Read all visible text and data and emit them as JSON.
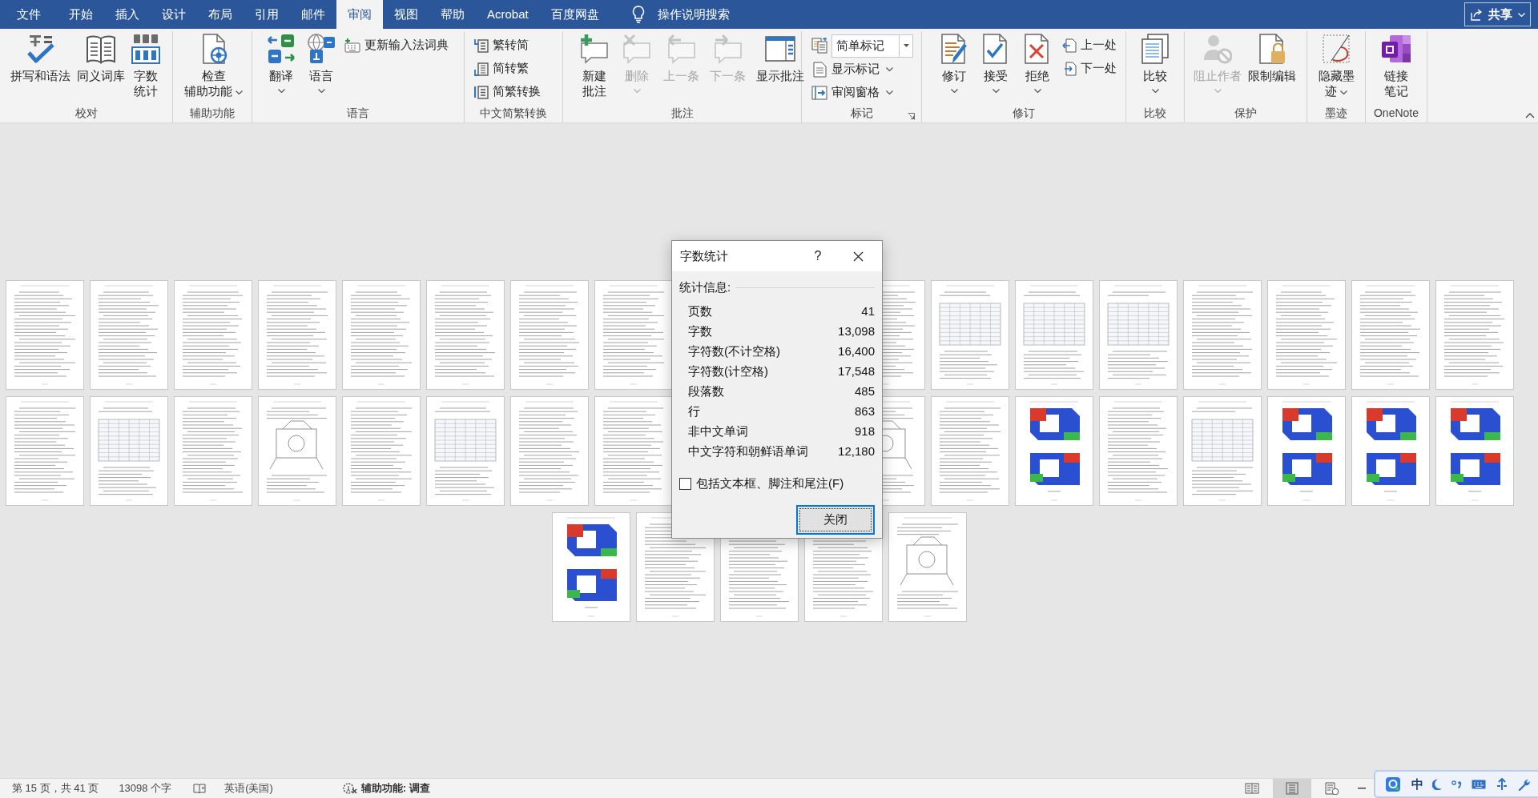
{
  "tabs": [
    {
      "label": "文件",
      "selected": false
    },
    {
      "label": "开始",
      "selected": false
    },
    {
      "label": "插入",
      "selected": false
    },
    {
      "label": "设计",
      "selected": false
    },
    {
      "label": "布局",
      "selected": false
    },
    {
      "label": "引用",
      "selected": false
    },
    {
      "label": "邮件",
      "selected": false
    },
    {
      "label": "审阅",
      "selected": true
    },
    {
      "label": "视图",
      "selected": false
    },
    {
      "label": "帮助",
      "selected": false
    },
    {
      "label": "Acrobat",
      "selected": false
    },
    {
      "label": "百度网盘",
      "selected": false
    }
  ],
  "search": {
    "placeholder": "操作说明搜索"
  },
  "share_button": {
    "label": "共享"
  },
  "ribbon": {
    "groups": [
      {
        "label": "校对",
        "launcher": false,
        "controls": [
          {
            "kind": "large",
            "lines": [
              "拼写和语法"
            ],
            "dropdown": false,
            "disabled": false
          },
          {
            "kind": "large",
            "lines": [
              "同义词库"
            ],
            "dropdown": false,
            "disabled": false
          },
          {
            "kind": "large",
            "lines": [
              "字数",
              "统计"
            ],
            "dropdown": false,
            "disabled": false
          }
        ]
      },
      {
        "label": "辅助功能",
        "launcher": false,
        "controls": [
          {
            "kind": "large",
            "lines": [
              "检查",
              "辅助功能"
            ],
            "dropdown": true,
            "disabled": false
          }
        ]
      },
      {
        "label": "语言",
        "launcher": false,
        "controls": [
          {
            "kind": "large",
            "lines": [
              "翻译"
            ],
            "dropdown": true,
            "disabled": false
          },
          {
            "kind": "large",
            "lines": [
              "语言"
            ],
            "dropdown": true,
            "disabled": false
          },
          {
            "kind": "stack",
            "items": [
              {
                "kind": "small",
                "label": "更新输入法词典",
                "dropdown": false,
                "disabled": false
              }
            ]
          }
        ]
      },
      {
        "label": "中文简繁转换",
        "launcher": false,
        "controls": [
          {
            "kind": "stack",
            "items": [
              {
                "kind": "small",
                "label": "繁转简",
                "dropdown": false,
                "disabled": false
              },
              {
                "kind": "small",
                "label": "简转繁",
                "dropdown": false,
                "disabled": false
              },
              {
                "kind": "small",
                "label": "简繁转换",
                "dropdown": false,
                "disabled": false
              }
            ]
          }
        ]
      },
      {
        "label": "批注",
        "launcher": false,
        "controls": [
          {
            "kind": "large",
            "lines": [
              "新建",
              "批注"
            ],
            "dropdown": false,
            "disabled": false
          },
          {
            "kind": "large",
            "lines": [
              "删除"
            ],
            "dropdown": true,
            "disabled": true
          },
          {
            "kind": "large",
            "lines": [
              "上一条"
            ],
            "dropdown": false,
            "disabled": true
          },
          {
            "kind": "large",
            "lines": [
              "下一条"
            ],
            "dropdown": false,
            "disabled": true
          },
          {
            "kind": "large",
            "lines": [
              "显示批注"
            ],
            "dropdown": false,
            "disabled": false
          }
        ]
      },
      {
        "label": "标记",
        "launcher": true,
        "controls": [
          {
            "kind": "stack",
            "items": [
              {
                "kind": "combo",
                "value": "简单标记"
              },
              {
                "kind": "small",
                "label": "显示标记",
                "dropdown": true,
                "disabled": false
              },
              {
                "kind": "small",
                "label": "审阅窗格",
                "dropdown": true,
                "disabled": false
              }
            ]
          }
        ]
      },
      {
        "label": "修订",
        "launcher": false,
        "controls": [
          {
            "kind": "large",
            "lines": [
              "修订"
            ],
            "dropdown": true,
            "disabled": false
          },
          {
            "kind": "large",
            "lines": [
              "接受"
            ],
            "dropdown": true,
            "disabled": false
          },
          {
            "kind": "large",
            "lines": [
              "拒绝"
            ],
            "dropdown": true,
            "disabled": false
          },
          {
            "kind": "stack",
            "items": [
              {
                "kind": "small",
                "label": "上一处",
                "dropdown": false,
                "disabled": false
              },
              {
                "kind": "small",
                "label": "下一处",
                "dropdown": false,
                "disabled": false
              }
            ]
          }
        ]
      },
      {
        "label": "比较",
        "launcher": false,
        "controls": [
          {
            "kind": "large",
            "lines": [
              "比较"
            ],
            "dropdown": true,
            "disabled": false
          }
        ]
      },
      {
        "label": "保护",
        "launcher": false,
        "controls": [
          {
            "kind": "large",
            "lines": [
              "阻止作者"
            ],
            "dropdown": true,
            "disabled": true
          },
          {
            "kind": "large",
            "lines": [
              "限制编辑"
            ],
            "dropdown": false,
            "disabled": false
          }
        ]
      },
      {
        "label": "墨迹",
        "launcher": false,
        "controls": [
          {
            "kind": "large",
            "lines": [
              "隐藏墨",
              "迹"
            ],
            "dropdown": true,
            "disabled": false
          }
        ]
      },
      {
        "label": "OneNote",
        "launcher": false,
        "controls": [
          {
            "kind": "large",
            "lines": [
              "链接",
              "笔记"
            ],
            "dropdown": false,
            "disabled": false
          }
        ]
      }
    ]
  },
  "pages": [
    {
      "kind": "text"
    },
    {
      "kind": "text"
    },
    {
      "kind": "text"
    },
    {
      "kind": "text"
    },
    {
      "kind": "text"
    },
    {
      "kind": "text"
    },
    {
      "kind": "text"
    },
    {
      "kind": "text"
    },
    {
      "kind": "covered"
    },
    {
      "kind": "covered"
    },
    {
      "kind": "text"
    },
    {
      "kind": "table"
    },
    {
      "kind": "table"
    },
    {
      "kind": "table"
    },
    {
      "kind": "text"
    },
    {
      "kind": "text"
    },
    {
      "kind": "text"
    },
    {
      "kind": "text"
    },
    {
      "kind": "text"
    },
    {
      "kind": "table"
    },
    {
      "kind": "text"
    },
    {
      "kind": "figure"
    },
    {
      "kind": "text"
    },
    {
      "kind": "table"
    },
    {
      "kind": "text"
    },
    {
      "kind": "text"
    },
    {
      "kind": "covered"
    },
    {
      "kind": "covered"
    },
    {
      "kind": "figure"
    },
    {
      "kind": "text"
    },
    {
      "kind": "model"
    },
    {
      "kind": "text"
    },
    {
      "kind": "table"
    },
    {
      "kind": "model"
    },
    {
      "kind": "model"
    },
    {
      "kind": "model"
    },
    {
      "kind": "model"
    },
    {
      "kind": "text"
    },
    {
      "kind": "text"
    },
    {
      "kind": "text"
    },
    {
      "kind": "figure"
    }
  ],
  "dialog": {
    "title": "字数统计",
    "help": "?",
    "section": "统计信息:",
    "stats": [
      {
        "label": "页数",
        "value": "41"
      },
      {
        "label": "字数",
        "value": "13,098"
      },
      {
        "label": "字符数(不计空格)",
        "value": "16,400"
      },
      {
        "label": "字符数(计空格)",
        "value": "17,548"
      },
      {
        "label": "段落数",
        "value": "485"
      },
      {
        "label": "行",
        "value": "863"
      },
      {
        "label": "非中文单词",
        "value": "918"
      },
      {
        "label": "中文字符和朝鲜语单词",
        "value": "12,180"
      }
    ],
    "checkbox": {
      "label": "包括文本框、脚注和尾注(F)",
      "checked": false
    },
    "close_button": "关闭"
  },
  "status_bar": {
    "page": "第 15 页，共 41 页",
    "words": "13098 个字",
    "language": "英语(美国)",
    "accessibility": "辅助功能: 调查",
    "views": [
      {
        "selected": false
      },
      {
        "selected": true
      },
      {
        "selected": false
      }
    ]
  },
  "ime_toolbar": {
    "mode": "中"
  }
}
